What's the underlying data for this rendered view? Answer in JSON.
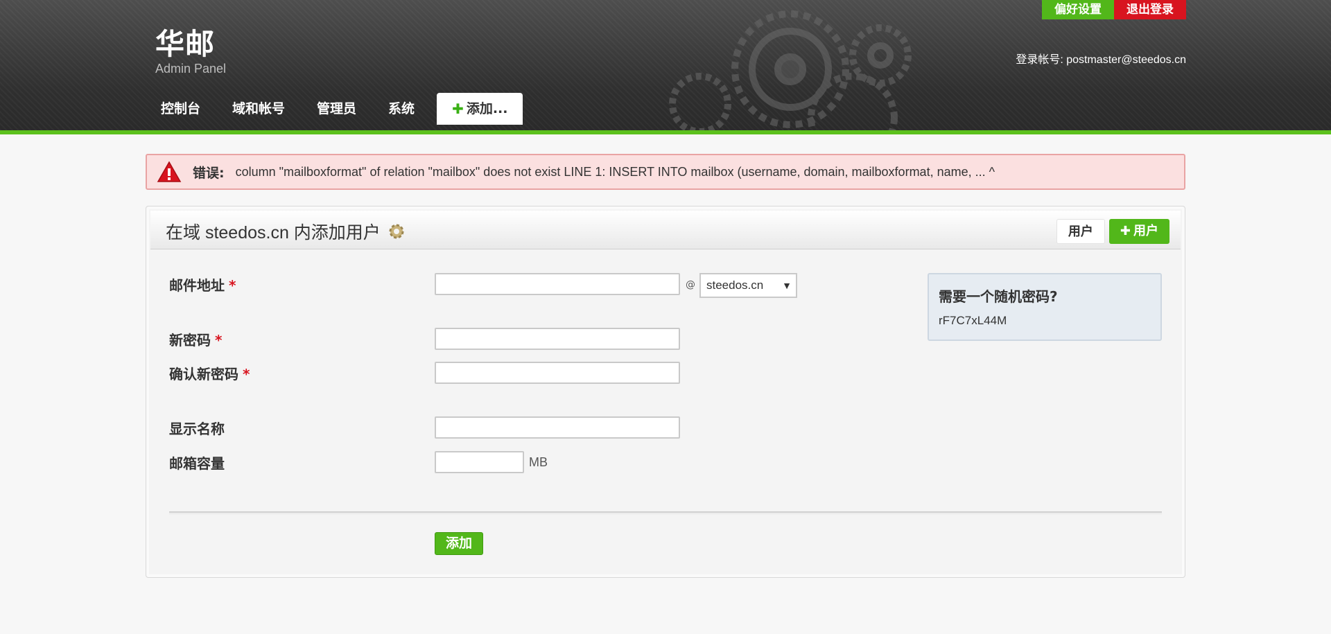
{
  "header": {
    "brand_name": "华邮",
    "brand_subtitle": "Admin Panel",
    "preferences_label": "偏好设置",
    "logout_label": "退出登录",
    "login_prefix": "登录帐号:",
    "login_account": "postmaster@steedos.cn",
    "colors": {
      "accent_green": "#5cc11d",
      "logout_red": "#d8141f"
    }
  },
  "nav": {
    "items": [
      {
        "label": "控制台"
      },
      {
        "label": "域和帐号"
      },
      {
        "label": "管理员"
      },
      {
        "label": "系统"
      }
    ],
    "add_label": "添加..."
  },
  "error": {
    "label": "错误:",
    "message": "column \"mailboxformat\" of relation \"mailbox\" does not exist LINE 1: INSERT INTO mailbox (username, domain, mailboxformat, name, ... ^"
  },
  "panel": {
    "title": "在域 steedos.cn 内添加用户",
    "users_button": "用户",
    "add_user_button": "用户"
  },
  "form": {
    "email_label": "邮件地址",
    "password_label": "新密码",
    "confirm_password_label": "确认新密码",
    "display_name_label": "显示名称",
    "quota_label": "邮箱容量",
    "required_mark": "*",
    "at_sign": "@",
    "domain_selected": "steedos.cn",
    "quota_unit": "MB",
    "submit_label": "添加"
  },
  "random_password": {
    "title": "需要一个随机密码?",
    "value": "rF7C7xL44M"
  }
}
